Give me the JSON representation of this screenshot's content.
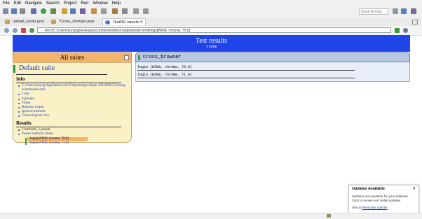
{
  "menu": [
    "File",
    "Edit",
    "Navigate",
    "Search",
    "Project",
    "Run",
    "Window",
    "Help"
  ],
  "toolbar": {
    "quick_access": "Quick Access"
  },
  "tabs": [
    {
      "label": "upload_photo.java",
      "active": false
    },
    {
      "label": "*Cross_browser.java",
      "active": false
    },
    {
      "label": "TestNG reports",
      "active": true
    }
  ],
  "browser": {
    "url": "file:///C:/Users/sunyog/workspace/Jumbotest/test-output/index.html#logs[WIN8, chrome, 70.0]"
  },
  "report": {
    "header_title": "Test results",
    "header_subtitle": "1 suite",
    "all_suites": "All suites",
    "suite_title": "Default suite",
    "info_heading": "Info",
    "info_items": [
      "C:\\Users\\sunyog\\AppData\\Local\\Temp\\testng-eclipse-1991098535\\testng-customsuite.xml",
      "1 test",
      "0 groups",
      "Times",
      "Reporter output",
      "Ignored methods",
      "Chronological view"
    ],
    "results_heading": "Results",
    "results_items": [
      "2 methods, 2 passed",
      "Passed methods (hide)"
    ],
    "passed_methods": [
      "login(WIN8, chrome, 70.0)",
      "login(WIN8, chrome, 71.0)"
    ],
    "class_name": "Cross_browser",
    "method_lines": [
      "login (WIN8, chrome, 70.0)",
      "login (WIN8, chrome, 71.0)"
    ]
  },
  "notification": {
    "title": "Updates Available",
    "body": "Updates are available for your software. Click to review and install updates.",
    "link_prefix": "Set up",
    "link": "Reminder options"
  },
  "colors": {
    "header_blue": "#1f44e8",
    "suite_bg": "#fbf1c6",
    "all_suites_bg": "#f3b36b",
    "method_bg": "#b8c8e4",
    "pass_green": "#2e9e3a"
  }
}
